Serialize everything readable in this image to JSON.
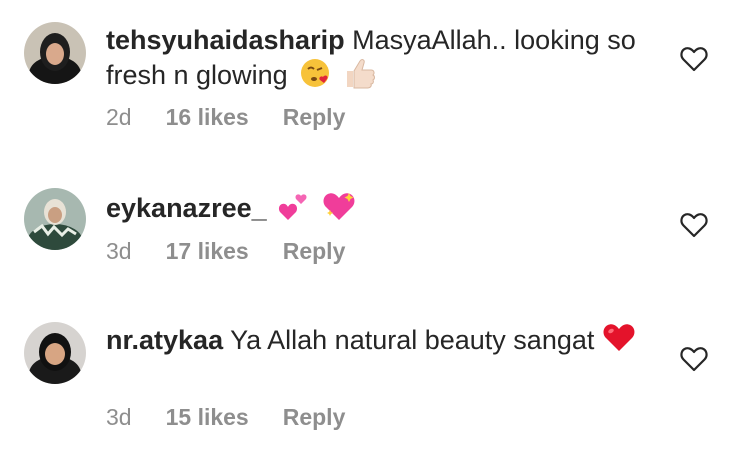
{
  "comments": [
    {
      "username": "tehsyuhaidasharip",
      "text": "MasyaAllah.. looking so fresh n glowing",
      "emojis": [
        "kiss-emoji",
        "thumbs-up-emoji"
      ],
      "time": "2d",
      "likes": "16 likes",
      "reply": "Reply"
    },
    {
      "username": "eykanazree_",
      "text": "",
      "emojis": [
        "two-hearts-emoji",
        "sparkling-heart-emoji"
      ],
      "time": "3d",
      "likes": "17 likes",
      "reply": "Reply"
    },
    {
      "username": "nr.atykaa",
      "text": "Ya Allah natural beauty sangat",
      "emojis": [
        "red-heart-emoji"
      ],
      "time": "3d",
      "likes": "15 likes",
      "reply": "Reply"
    }
  ],
  "colors": {
    "text": "#262626",
    "meta": "#8e8e8e",
    "heart_outline": "#262626"
  }
}
